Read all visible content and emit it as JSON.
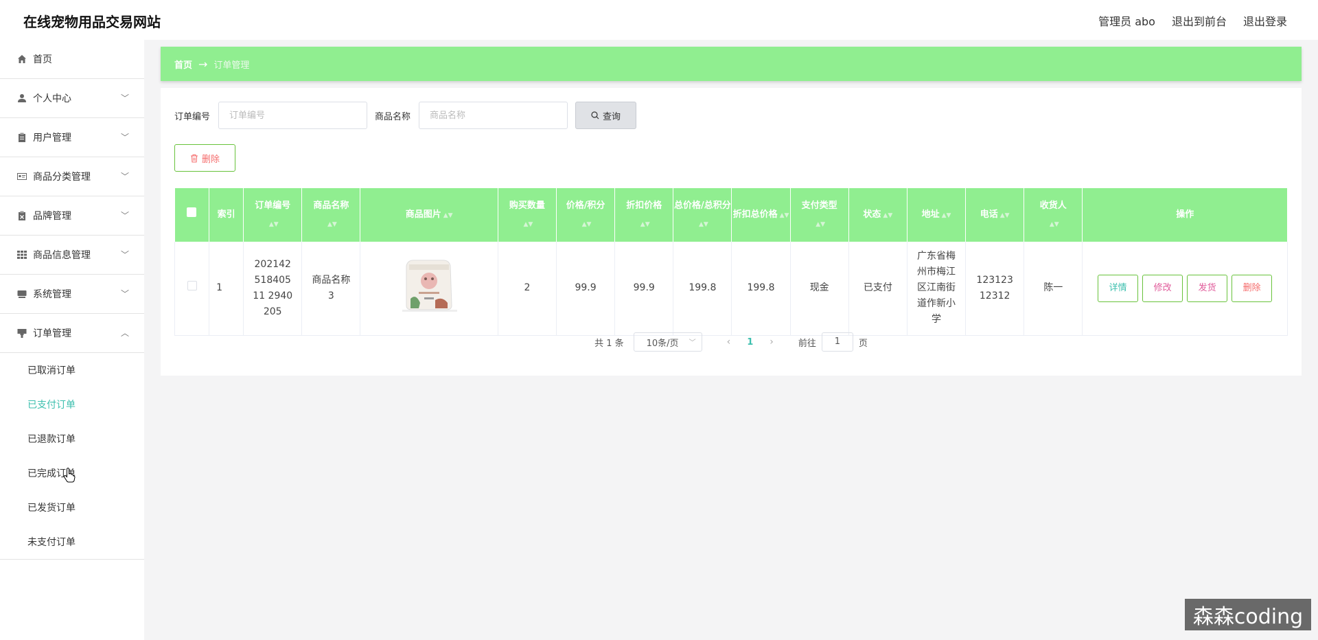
{
  "header": {
    "site_title": "在线宠物用品交易网站",
    "admin_label": "管理员 abo",
    "exit_front": "退出到前台",
    "logout": "退出登录"
  },
  "sidebar": {
    "items": [
      {
        "label": "首页",
        "icon": "home-icon"
      },
      {
        "label": "个人中心",
        "icon": "user-icon"
      },
      {
        "label": "用户管理",
        "icon": "clipboard-icon"
      },
      {
        "label": "商品分类管理",
        "icon": "id-card-icon"
      },
      {
        "label": "品牌管理",
        "icon": "clipboard-x-icon"
      },
      {
        "label": "商品信息管理",
        "icon": "grid-icon"
      },
      {
        "label": "系统管理",
        "icon": "hdd-icon"
      },
      {
        "label": "订单管理",
        "icon": "order-icon"
      }
    ],
    "sub_items": [
      "已取消订单",
      "已支付订单",
      "已退款订单",
      "已完成订单",
      "已发货订单",
      "未支付订单"
    ],
    "active_sub": "已支付订单"
  },
  "breadcrumb": {
    "home": "首页",
    "arrow": "→",
    "current": "订单管理"
  },
  "search": {
    "order_label": "订单编号",
    "order_placeholder": "订单编号",
    "product_label": "商品名称",
    "product_placeholder": "商品名称",
    "search_button": "查询"
  },
  "delete_button": "删除",
  "table": {
    "headers": [
      "索引",
      "订单编号",
      "商品名称",
      "商品图片",
      "购买数量",
      "价格/积分",
      "折扣价格",
      "总价格/总积分",
      "折扣总价格",
      "支付类型",
      "状态",
      "地址",
      "电话",
      "收货人",
      "操作"
    ],
    "rows": [
      {
        "index": "1",
        "order_no": "20214251840511 2940205",
        "product_name": "商品名称3",
        "quantity": "2",
        "price": "99.9",
        "discount_price": "99.9",
        "total_price": "199.8",
        "discount_total": "199.8",
        "pay_type": "现金",
        "status": "已支付",
        "address": "广东省梅州市梅江区江南街道作新小学",
        "phone": "12312312312",
        "receiver": "陈一"
      }
    ],
    "actions": {
      "detail": "详情",
      "edit": "修改",
      "ship": "发货",
      "delete": "删除"
    }
  },
  "pagination": {
    "total": "共 1 条",
    "page_size": "10条/页",
    "current_page": "1",
    "goto_label": "前往",
    "goto_value": "1",
    "page_suffix": "页"
  },
  "watermark": "森森coding",
  "colors": {
    "header_green": "#90ee90",
    "accent_teal": "#3cbfae",
    "danger": "#f56c6c"
  }
}
